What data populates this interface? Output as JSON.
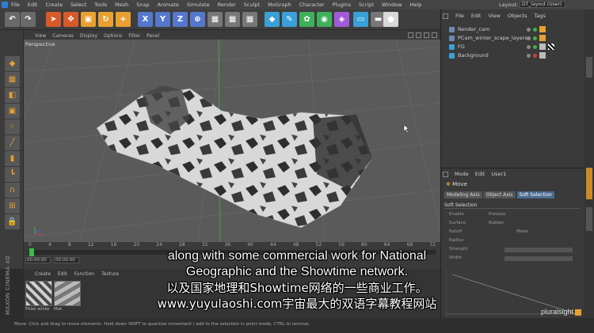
{
  "menubar": {
    "items": [
      "File",
      "Edit",
      "Create",
      "Select",
      "Tools",
      "Mesh",
      "Snap",
      "Animate",
      "Simulate",
      "Render",
      "Sculpt",
      "MoGraph",
      "Character",
      "Plugins",
      "Script",
      "Window",
      "Help"
    ],
    "layout_label": "Layout:",
    "layout_value": "DT_layout (User)"
  },
  "toolbar": {
    "buttons": [
      {
        "label": "↶",
        "icon": "undo-icon",
        "color": "#6a6a6a"
      },
      {
        "label": "↷",
        "icon": "redo-icon",
        "color": "#6a6a6a"
      },
      {
        "label": "➤",
        "icon": "select-icon",
        "color": "#d85a2a"
      },
      {
        "label": "✥",
        "icon": "move-icon",
        "color": "#d85a2a"
      },
      {
        "label": "▣",
        "icon": "scale-icon",
        "color": "#e8a030"
      },
      {
        "label": "↻",
        "icon": "rotate-icon",
        "color": "#e8a030"
      },
      {
        "label": "+",
        "icon": "live-selection-icon",
        "color": "#e8a030"
      },
      {
        "label": "X",
        "icon": "x-axis-icon",
        "color": "#5577cc"
      },
      {
        "label": "Y",
        "icon": "y-axis-icon",
        "color": "#5577cc"
      },
      {
        "label": "Z",
        "icon": "z-axis-icon",
        "color": "#5577cc"
      },
      {
        "label": "⊕",
        "icon": "coordinate-system-icon",
        "color": "#5577cc"
      },
      {
        "label": "▦",
        "icon": "render-view-icon",
        "color": "#777"
      },
      {
        "label": "▦",
        "icon": "render-picture-viewer-icon",
        "color": "#777"
      },
      {
        "label": "▦",
        "icon": "render-settings-icon",
        "color": "#777"
      },
      {
        "label": "◆",
        "icon": "cube-icon",
        "color": "#3aa0d8"
      },
      {
        "label": "✎",
        "icon": "pen-icon",
        "color": "#3aa0d8"
      },
      {
        "label": "✿",
        "icon": "subdivision-icon",
        "color": "#3fb05a"
      },
      {
        "label": "◉",
        "icon": "array-icon",
        "color": "#3fb05a"
      },
      {
        "label": "◈",
        "icon": "deformer-icon",
        "color": "#a05ad8"
      },
      {
        "label": "▭",
        "icon": "floor-icon",
        "color": "#3aa0d8"
      },
      {
        "label": "▬",
        "icon": "camera-icon",
        "color": "#777"
      },
      {
        "label": "●",
        "icon": "light-icon",
        "color": "#d8d8d8"
      }
    ]
  },
  "left_toolbar": {
    "buttons": [
      "cube-mode-icon",
      "checker-icon",
      "model-mode-icon",
      "object-icon",
      "points-icon",
      "edges-icon",
      "polygons-icon",
      "axis-icon",
      "magnet-icon",
      "snap-icon",
      "lock-icon"
    ]
  },
  "viewport": {
    "menu": [
      "View",
      "Cameras",
      "Display",
      "Options",
      "Filter",
      "Panel"
    ],
    "label": "Perspective"
  },
  "timeline": {
    "ticks": [
      "0",
      "4",
      "8",
      "12",
      "16",
      "20",
      "24",
      "28",
      "32",
      "36",
      "40",
      "44",
      "48",
      "52",
      "56",
      "60",
      "64",
      "68",
      "72"
    ],
    "frames": [
      "00:00:00",
      "00:00:00"
    ]
  },
  "materials": {
    "menu": [
      "Create",
      "Edit",
      "Function",
      "Texture"
    ],
    "items": [
      "Pklat winte",
      "Mat"
    ],
    "logo": "MAXON CINEMA 4D"
  },
  "object_manager": {
    "menu": [
      "File",
      "Edit",
      "View",
      "Objects",
      "Tags"
    ],
    "objects": [
      {
        "name": "Render_cam",
        "color": "#6a8ab0"
      },
      {
        "name": "PCam_winter_scape_layers",
        "color": "#6a8ab0"
      },
      {
        "name": "FG",
        "color": "#3aa0d8"
      },
      {
        "name": "Background",
        "color": "#3aa0d8"
      }
    ]
  },
  "attribute_manager": {
    "menu": [
      "Mode",
      "Edit",
      "User1"
    ],
    "tool": "Move",
    "tabs": [
      "Modeling Axis",
      "Object Axis",
      "Soft Selection"
    ],
    "section": "Soft Selection",
    "options": [
      {
        "label": "Enable",
        "right": "Preview"
      },
      {
        "label": "Surface",
        "right": "Rubber"
      },
      {
        "label": "Falloff",
        "right": "Mode"
      },
      {
        "label": "Radius",
        "right": ""
      },
      {
        "label": "Strength",
        "right": ""
      },
      {
        "label": "Width",
        "right": ""
      }
    ]
  },
  "status": {
    "text": "Move: Click and drag to move elements. Hold down SHIFT to quantize movement / add to the selection in point mode, CTRL to remove."
  },
  "subtitles": {
    "line1": "along with some commercial work for National",
    "line2": "Geographic and the Showtime network.",
    "line3": "以及国家地理和Showtime网络的一些商业工作。",
    "line4": "www.yuyulaoshi.com宇宙最大的双语字幕教程网站"
  },
  "brand": "pluralsight"
}
